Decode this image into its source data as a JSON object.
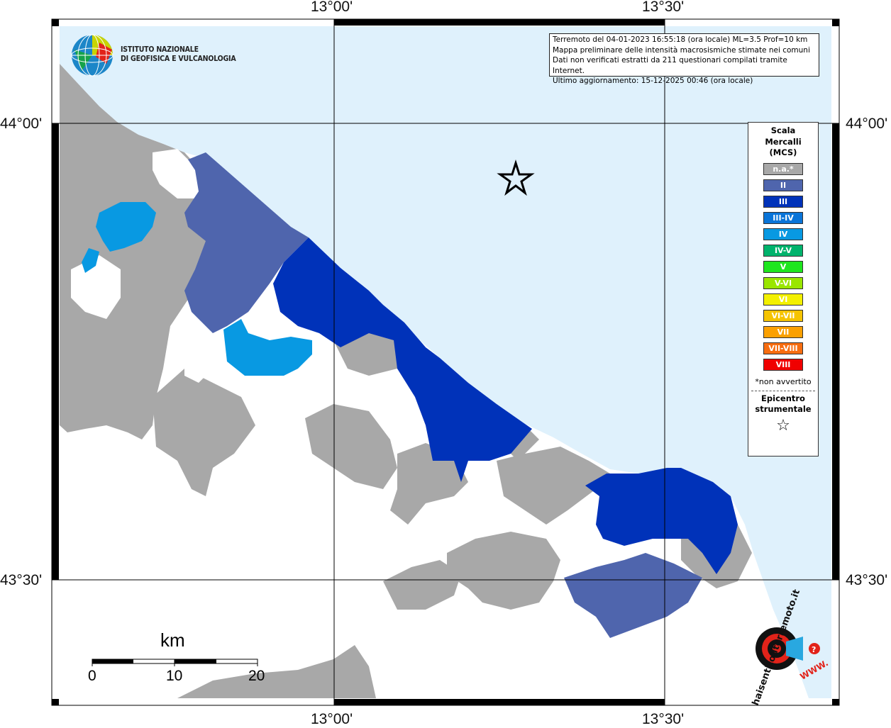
{
  "map": {
    "lon_labels": [
      "13°00'",
      "13°30'"
    ],
    "lat_labels": [
      "44°00'",
      "43°30'"
    ],
    "sea_color": "#dff1fc",
    "na_color": "#a8a8a8"
  },
  "info": {
    "line1": "Terremoto del 04-01-2023 16:55:18 (ora locale) ML=3.5 Prof=10 km",
    "line2": "Mappa preliminare delle intensità macrosismiche stimate nei comuni",
    "line3": "Dati non verificati estratti da 211 questionari compilati tramite Internet.",
    "line4": "Ultimo aggiornamento: 15-12-2025 00:46 (ora locale)"
  },
  "logo": {
    "line1": "ISTITUTO NAZIONALE",
    "line2": "DI GEOFISICA E VULCANOLOGIA"
  },
  "legend": {
    "title1": "Scala",
    "title2": "Mercalli",
    "title3": "(MCS)",
    "items": [
      {
        "label": "n.a.*",
        "color": "#a8a8a8"
      },
      {
        "label": "II",
        "color": "#4f65ad"
      },
      {
        "label": "III",
        "color": "#0032b9"
      },
      {
        "label": "III-IV",
        "color": "#0a74d8"
      },
      {
        "label": "IV",
        "color": "#0899e2"
      },
      {
        "label": "IV-V",
        "color": "#00b36c"
      },
      {
        "label": "V",
        "color": "#1ee61e"
      },
      {
        "label": "V-VI",
        "color": "#9ae600"
      },
      {
        "label": "VI",
        "color": "#f3f000"
      },
      {
        "label": "VI-VII",
        "color": "#f6c400"
      },
      {
        "label": "VII",
        "color": "#fba000"
      },
      {
        "label": "VII-VIII",
        "color": "#f76d10"
      },
      {
        "label": "VIII",
        "color": "#f00000"
      }
    ],
    "note": "*non avvertito",
    "epi1": "Epicentro",
    "epi2": "strumentale",
    "star": "☆"
  },
  "scale": {
    "unit": "km",
    "labels": [
      "0",
      "10",
      "20"
    ]
  },
  "watermark": {
    "text": "haisentitoilterremoto.it",
    "url": "WWW."
  }
}
